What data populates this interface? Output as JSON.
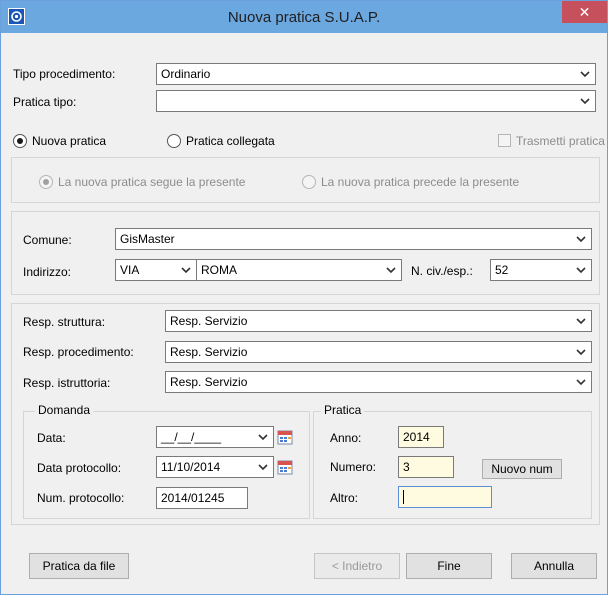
{
  "window": {
    "title": "Nuova pratica S.U.A.P.",
    "close_label": "✕"
  },
  "top": {
    "tipo_label": "Tipo procedimento:",
    "tipo_value": "Ordinario",
    "pratica_tipo_label": "Pratica tipo:",
    "pratica_tipo_value": ""
  },
  "radios": {
    "nuova": "Nuova pratica",
    "collegata": "Pratica collegata",
    "trasmetti": "Trasmetti pratica",
    "segue": "La nuova pratica segue la presente",
    "precede": "La nuova pratica precede la presente"
  },
  "location": {
    "comune_label": "Comune:",
    "comune_value": "GisMaster",
    "indirizzo_label": "Indirizzo:",
    "via_type": "VIA",
    "street": "ROMA",
    "civ_label": "N. civ./esp.:",
    "civ_value": "52"
  },
  "resp": {
    "struttura_label": "Resp. struttura:",
    "struttura_value": "Resp. Servizio",
    "procedimento_label": "Resp. procedimento:",
    "procedimento_value": "Resp. Servizio",
    "istruttoria_label": "Resp. istruttoria:",
    "istruttoria_value": "Resp. Servizio"
  },
  "domanda": {
    "title": "Domanda",
    "data_label": "Data:",
    "data_value": "__/__/____",
    "data_prot_label": "Data protocollo:",
    "data_prot_value": "11/10/2014",
    "num_prot_label": "Num. protocollo:",
    "num_prot_value": "2014/01245"
  },
  "pratica": {
    "title": "Pratica",
    "anno_label": "Anno:",
    "anno_value": "2014",
    "numero_label": "Numero:",
    "numero_value": "3",
    "nuovo_num": "Nuovo num",
    "altro_label": "Altro:",
    "altro_value": ""
  },
  "buttons": {
    "from_file": "Pratica da file",
    "back": "< Indietro",
    "finish": "Fine",
    "cancel": "Annulla"
  }
}
